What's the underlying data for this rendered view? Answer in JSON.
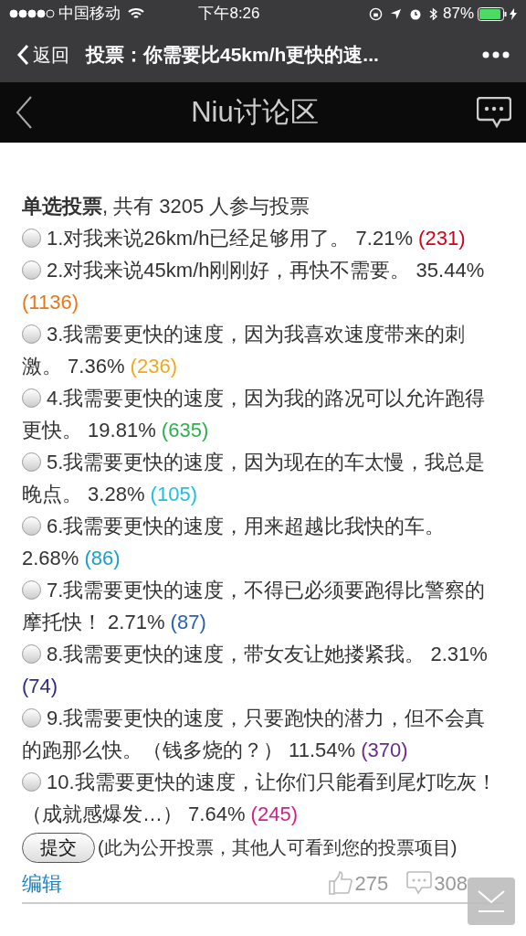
{
  "status_bar": {
    "carrier": "中国移动",
    "time": "下午8:26",
    "battery": "87%"
  },
  "nav_bar": {
    "back": "返回",
    "title": "投票：你需要比45km/h更快的速..."
  },
  "header": {
    "title": "Niu讨论区"
  },
  "poll": {
    "type_label": "单选投票",
    "summary": ", 共有 3205 人参与投票",
    "options": [
      {
        "text": "1.对我来说26km/h已经足够用了。",
        "percent": "7.21%",
        "count": "(231)",
        "color": "#d0021b",
        "selected": false
      },
      {
        "text": "2.对我来说45km/h刚刚好，再快不需要。",
        "percent": "35.44%",
        "count": "(1136)",
        "color": "#e8761a",
        "selected": false
      },
      {
        "text": "3.我需要更快的速度，因为我喜欢速度带来的刺激。",
        "percent": "7.36%",
        "count": "(236)",
        "color": "#f0a81e",
        "selected": false
      },
      {
        "text": "4.我需要更快的速度，因为我的路况可以允许跑得更快。",
        "percent": "19.81%",
        "count": "(635)",
        "color": "#2bb14a",
        "selected": false
      },
      {
        "text": "5.我需要更快的速度，因为现在的车太慢，我总是晚点。",
        "percent": "3.28%",
        "count": "(105)",
        "color": "#1ec0e0",
        "selected": false
      },
      {
        "text": "6.我需要更快的速度，用来超越比我快的车。",
        "percent": "2.68%",
        "count": "(86)",
        "color": "#1a9fc8",
        "selected": false
      },
      {
        "text": "7.我需要更快的速度，不得已必须要跑得比警察的摩托快！",
        "percent": "2.71%",
        "count": "(87)",
        "color": "#2a5fae",
        "selected": false
      },
      {
        "text": "8.我需要更快的速度，带女友让她搂紧我。",
        "percent": "2.31%",
        "count": "(74)",
        "color": "#2e2a86",
        "selected": false
      },
      {
        "text": "9.我需要更快的速度，只要跑快的潜力，但不会真的跑那么快。（钱多烧的？）",
        "percent": "11.54%",
        "count": "(370)",
        "color": "#6a2a90",
        "selected": false
      },
      {
        "text": "10.我需要更快的速度，让你们只能看到尾灯吃灰！（成就感爆发…）",
        "percent": "7.64%",
        "count": "(245)",
        "color": "#d0208a",
        "selected": false
      }
    ],
    "submit": "提交",
    "note": "(此为公开投票，其他人可看到您的投票项目)"
  },
  "footer": {
    "edit": "编辑",
    "likes": "275",
    "comments": "308"
  }
}
